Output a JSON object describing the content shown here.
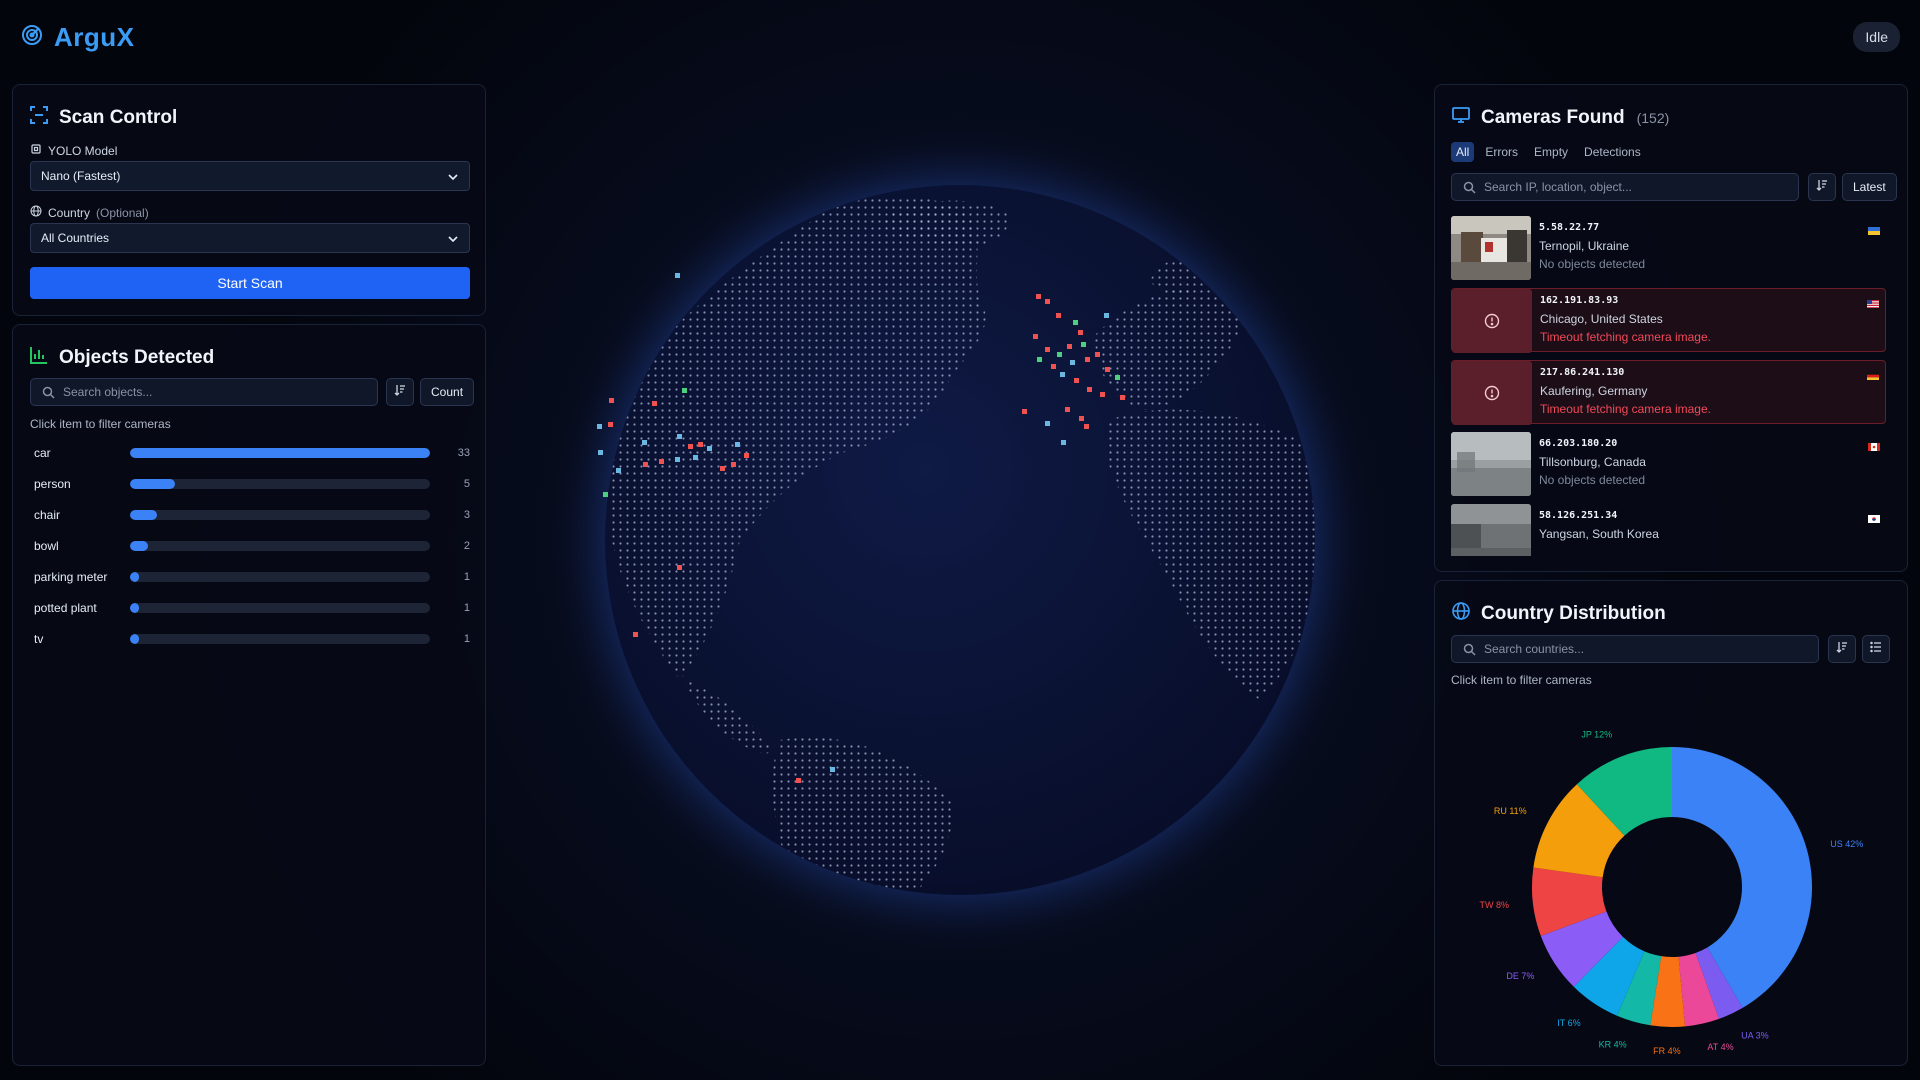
{
  "app": {
    "name": "ArguX",
    "status": "Idle"
  },
  "scan_control": {
    "title": "Scan Control",
    "model_label": "YOLO Model",
    "model_value": "Nano (Fastest)",
    "country_label": "Country",
    "country_optional": "(Optional)",
    "country_value": "All Countries",
    "start_button": "Start Scan"
  },
  "objects": {
    "title": "Objects Detected",
    "search_placeholder": "Search objects...",
    "sort_button": "Count",
    "hint": "Click item to filter cameras",
    "items": [
      {
        "name": "car",
        "count": 33
      },
      {
        "name": "person",
        "count": 5
      },
      {
        "name": "chair",
        "count": 3
      },
      {
        "name": "bowl",
        "count": 2
      },
      {
        "name": "parking meter",
        "count": 1
      },
      {
        "name": "potted plant",
        "count": 1
      },
      {
        "name": "tv",
        "count": 1
      }
    ]
  },
  "cameras": {
    "title": "Cameras Found",
    "count": "(152)",
    "tabs": [
      "All",
      "Errors",
      "Empty",
      "Detections"
    ],
    "active_tab": "All",
    "search_placeholder": "Search IP, location, object...",
    "sort_button": "Latest",
    "items": [
      {
        "ip": "5.58.22.77",
        "location": "Ternopil, Ukraine",
        "status": "No objects detected",
        "error": false,
        "flag": "ukraine-flag-icon"
      },
      {
        "ip": "162.191.83.93",
        "location": "Chicago, United States",
        "status": "Timeout fetching camera image.",
        "error": true,
        "flag": "usa-flag-icon"
      },
      {
        "ip": "217.86.241.130",
        "location": "Kaufering, Germany",
        "status": "Timeout fetching camera image.",
        "error": true,
        "flag": "germany-flag-icon"
      },
      {
        "ip": "66.203.180.20",
        "location": "Tillsonburg, Canada",
        "status": "No objects detected",
        "error": false,
        "flag": "canada-flag-icon"
      },
      {
        "ip": "58.126.251.34",
        "location": "Yangsan, South Korea",
        "status": "",
        "error": false,
        "flag": "south-korea-flag-icon"
      }
    ]
  },
  "country_distribution": {
    "title": "Country Distribution",
    "search_placeholder": "Search countries...",
    "hint": "Click item to filter cameras"
  },
  "chart_data": {
    "type": "pie",
    "donut": true,
    "categories": [
      "US",
      "UA",
      "AT",
      "FR",
      "KR",
      "IT",
      "DE",
      "TW",
      "RU",
      "JP"
    ],
    "values": [
      42,
      3,
      4,
      4,
      4,
      6,
      7,
      8,
      11,
      12
    ],
    "labels": [
      "US 42%",
      "UA 3%",
      "AT 4%",
      "FR 4%",
      "KR 4%",
      "IT 6%",
      "DE 7%",
      "TW 8%",
      "RU 11%",
      "JP 12%"
    ],
    "colors": [
      "#3b82f6",
      "#7c5cf0",
      "#ec4899",
      "#f97316",
      "#14b8a6",
      "#0ea5e9",
      "#8b5cf6",
      "#ef4444",
      "#f59e0b",
      "#10b981"
    ]
  },
  "theme": {
    "accent": "#3b82f6",
    "primary_button": "#1f63f5",
    "error": "#f04a5a"
  }
}
